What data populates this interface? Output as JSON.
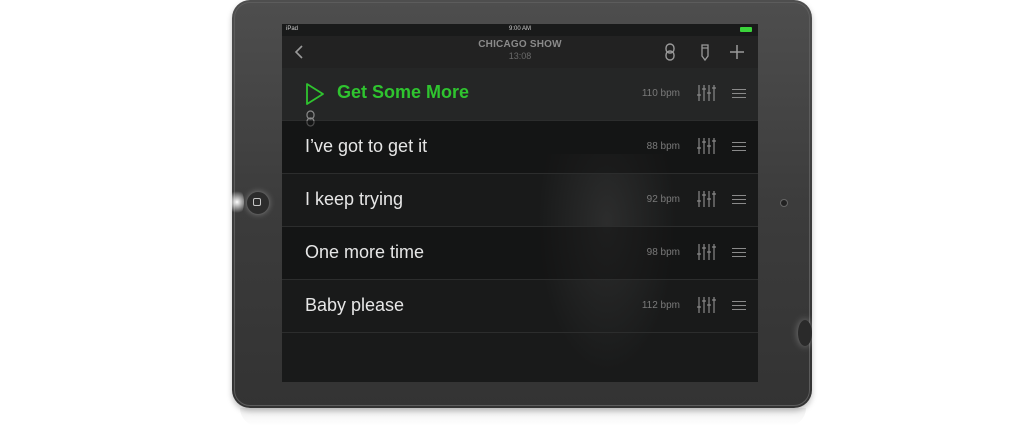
{
  "statusbar": {
    "carrier": "iPad",
    "time": "9:00 AM"
  },
  "navbar": {
    "title": "CHICAGO SHOW",
    "subtitle": "13:08",
    "icons": [
      "back-chevron-icon",
      "link-icon",
      "pencil-icon",
      "plus-icon"
    ]
  },
  "songs": [
    {
      "title": "Get Some More",
      "bpm": "110 bpm",
      "playing": true
    },
    {
      "title": "I’ve got to get it",
      "bpm": "88 bpm",
      "playing": false
    },
    {
      "title": "I keep trying",
      "bpm": "92 bpm",
      "playing": false
    },
    {
      "title": "One more time",
      "bpm": "98 bpm",
      "playing": false
    },
    {
      "title": "Baby please",
      "bpm": "112 bpm",
      "playing": false
    }
  ],
  "colors": {
    "accent": "#2fc42f",
    "background": "#191a1a",
    "battery": "#3bd43b"
  }
}
